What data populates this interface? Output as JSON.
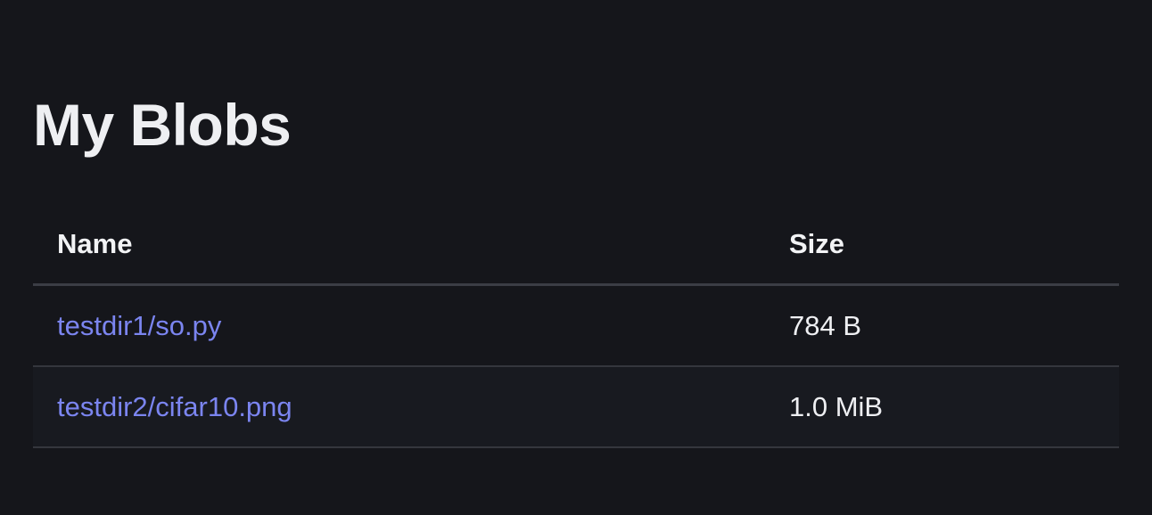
{
  "page": {
    "title": "My Blobs"
  },
  "table": {
    "columns": {
      "name": "Name",
      "size": "Size"
    },
    "rows": [
      {
        "name": "testdir1/so.py",
        "size": "784 B"
      },
      {
        "name": "testdir2/cifar10.png",
        "size": "1.0 MiB"
      }
    ]
  },
  "colors": {
    "background": "#15161b",
    "text": "#eeeff2",
    "link": "#7b85f0",
    "divider": "#3b3d45"
  }
}
